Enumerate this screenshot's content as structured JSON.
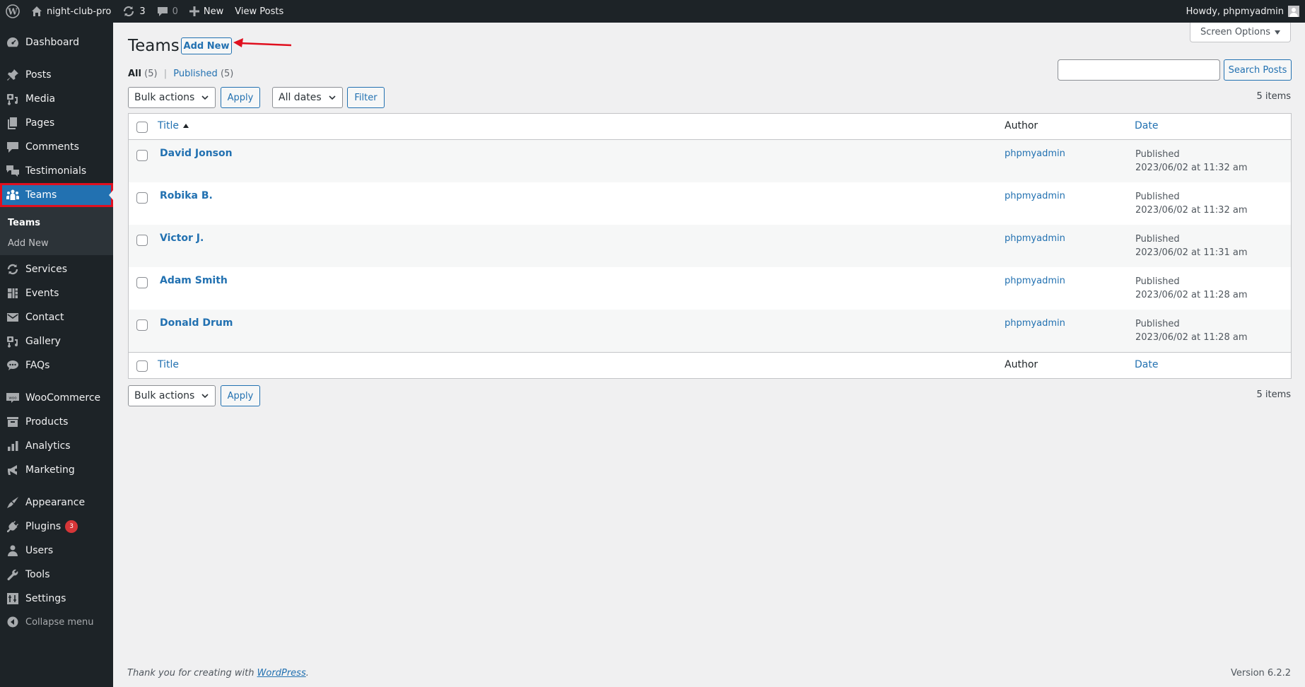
{
  "adminbar": {
    "site_name": "night-club-pro",
    "updates_count": "3",
    "comments_count": "0",
    "new_label": "New",
    "view_posts_label": "View Posts",
    "howdy": "Howdy, phpmyadmin"
  },
  "sidebar": {
    "items": [
      {
        "label": "Dashboard",
        "icon": "dashboard-icon"
      },
      {
        "label": "Posts",
        "icon": "pin-icon"
      },
      {
        "label": "Media",
        "icon": "media-icon"
      },
      {
        "label": "Pages",
        "icon": "pages-icon"
      },
      {
        "label": "Comments",
        "icon": "comment-icon"
      },
      {
        "label": "Testimonials",
        "icon": "testimonials-icon"
      },
      {
        "label": "Teams",
        "icon": "groups-icon"
      },
      {
        "label": "Services",
        "icon": "update-icon"
      },
      {
        "label": "Events",
        "icon": "events-icon"
      },
      {
        "label": "Contact",
        "icon": "email-icon"
      },
      {
        "label": "Gallery",
        "icon": "gallery-icon"
      },
      {
        "label": "FAQs",
        "icon": "faq-icon"
      },
      {
        "label": "WooCommerce",
        "icon": "woocommerce-icon"
      },
      {
        "label": "Products",
        "icon": "archive-icon"
      },
      {
        "label": "Analytics",
        "icon": "chart-icon"
      },
      {
        "label": "Marketing",
        "icon": "megaphone-icon"
      },
      {
        "label": "Appearance",
        "icon": "brush-icon"
      },
      {
        "label": "Plugins",
        "icon": "plug-icon",
        "badge": "3"
      },
      {
        "label": "Users",
        "icon": "user-icon"
      },
      {
        "label": "Tools",
        "icon": "wrench-icon"
      },
      {
        "label": "Settings",
        "icon": "settings-icon"
      }
    ],
    "submenu": [
      "Teams",
      "Add New"
    ],
    "collapse_label": "Collapse menu"
  },
  "header": {
    "screen_options": "Screen Options",
    "title": "Teams",
    "add_new": "Add New"
  },
  "views": {
    "all_label": "All",
    "all_count": "(5)",
    "separator": "|",
    "published_label": "Published",
    "published_count": "(5)"
  },
  "search": {
    "value": "",
    "button": "Search Posts"
  },
  "filters": {
    "bulk_actions": "Bulk actions",
    "apply": "Apply",
    "dates": "All dates",
    "filter": "Filter",
    "items_count": "5 items"
  },
  "table": {
    "columns": {
      "title": "Title",
      "author": "Author",
      "date": "Date"
    },
    "rows": [
      {
        "title": "David Jonson",
        "author": "phpmyadmin",
        "status": "Published",
        "date": "2023/06/02 at 11:32 am"
      },
      {
        "title": "Robika B.",
        "author": "phpmyadmin",
        "status": "Published",
        "date": "2023/06/02 at 11:32 am"
      },
      {
        "title": "Victor J.",
        "author": "phpmyadmin",
        "status": "Published",
        "date": "2023/06/02 at 11:31 am"
      },
      {
        "title": "Adam Smith",
        "author": "phpmyadmin",
        "status": "Published",
        "date": "2023/06/02 at 11:28 am"
      },
      {
        "title": "Donald Drum",
        "author": "phpmyadmin",
        "status": "Published",
        "date": "2023/06/02 at 11:28 am"
      }
    ]
  },
  "footer": {
    "thanks_prefix": "Thank you for creating with ",
    "thanks_link": "WordPress",
    "thanks_suffix": ".",
    "version": "Version 6.2.2"
  },
  "colors": {
    "accent": "#2271b1",
    "annotation": "#e0101f",
    "admin_bg": "#1d2327"
  }
}
